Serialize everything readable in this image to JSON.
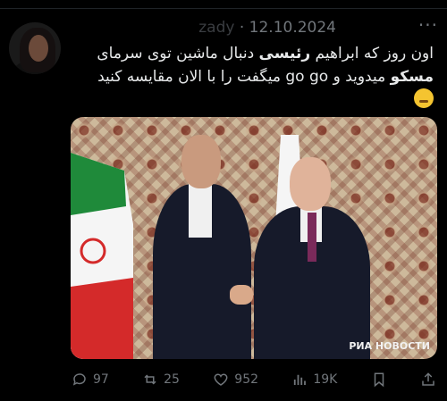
{
  "tweet": {
    "handle": "zady",
    "separator": "·",
    "date": "12.10.2024",
    "line1": "اون روز که ابراهیم ",
    "line1_bold": "رئیسی",
    "line1_end": " دنبال ماشین توی سرمای",
    "line2_bold": "مسکو",
    "line2_end": " میدوید و go go میگفت را با الان مقایسه کنید",
    "more_label": "···"
  },
  "media": {
    "watermark": "РИА НОВОСТИ"
  },
  "actions": {
    "replies": "97",
    "reposts": "25",
    "likes": "952",
    "views": "19K"
  },
  "colors": {
    "background": "#000000",
    "muted": "#71767b",
    "text": "#e7e9ea"
  },
  "icons": [
    "reply-icon",
    "repost-icon",
    "like-icon",
    "views-icon",
    "bookmark-icon",
    "share-icon",
    "more-icon"
  ]
}
